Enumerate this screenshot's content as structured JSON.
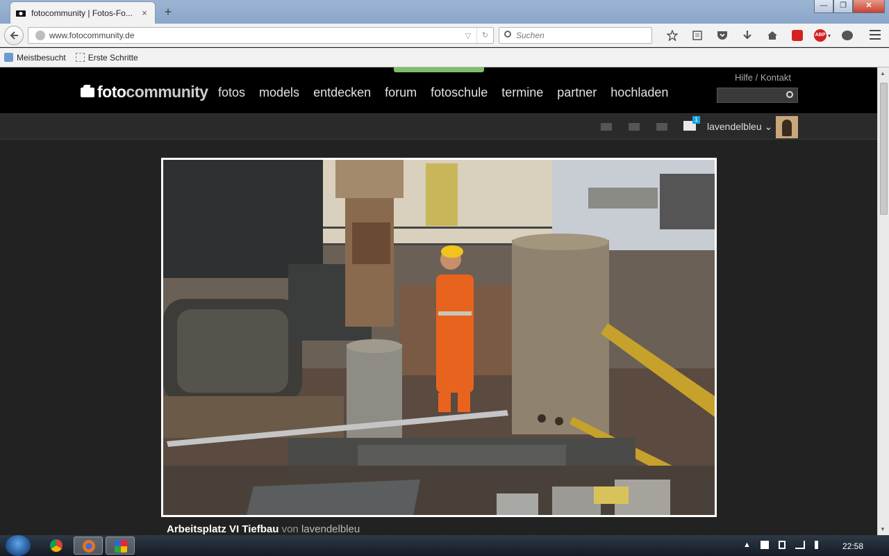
{
  "browser": {
    "tab_title": "fotocommunity | Fotos-Fo...",
    "tab_close": "×",
    "new_tab": "+",
    "url": "www.fotocommunity.de",
    "search_placeholder": "Suchen",
    "window_buttons": [
      "—",
      "❐",
      "✕"
    ],
    "bookmarks": [
      "Meistbesucht",
      "Erste Schritte"
    ],
    "toolbar_icons": [
      "star-icon",
      "reading-list-icon",
      "pocket-icon",
      "download-icon",
      "home-icon",
      "acrobat-icon",
      "adblock-icon",
      "chat-icon"
    ],
    "adblock_label": "ABP"
  },
  "site": {
    "logo_light": "foto",
    "logo_bold": "community",
    "nav": [
      "fotos",
      "models",
      "entdecken",
      "forum",
      "fotoschule",
      "termine",
      "partner",
      "hochladen"
    ],
    "help": "Hilfe / Kontakt",
    "notifications_badge": "1",
    "username": "lavendelbleu",
    "username_chevron": "⌄"
  },
  "photo": {
    "title": "Arbeitsplatz VI Tiefbau",
    "by": "von",
    "author": "lavendelbleu"
  },
  "taskbar": {
    "clock": "22:58",
    "tray_arrow": "▲",
    "tray_icons": [
      "flag-icon",
      "power-icon",
      "network-icon",
      "volume-icon"
    ]
  },
  "colors": {
    "site_bg": "#222222",
    "header_bg": "#000000",
    "accent_green": "#7fbf6a",
    "badge_blue": "#19a3e0"
  }
}
